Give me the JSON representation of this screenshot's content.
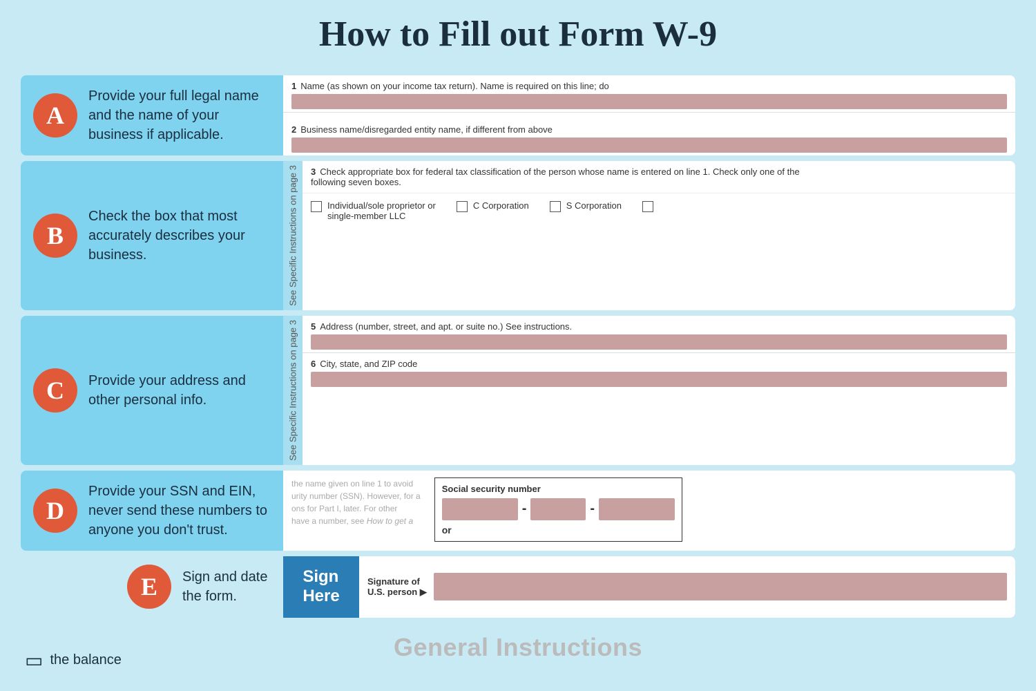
{
  "page": {
    "title": "How to Fill out Form W-9",
    "background_color": "#c8eaf5"
  },
  "sections": {
    "a": {
      "badge": "A",
      "description": "Provide your full legal name and the name of your business if applicable.",
      "field1_num": "1",
      "field1_label": "Name (as shown on your income tax return). Name is required on this line; do",
      "field2_num": "2",
      "field2_label": "Business name/disregarded entity name, if different from above"
    },
    "b": {
      "badge": "B",
      "description": "Check the box that most accurately describes your business.",
      "side_label": "See Specific Instructions on page 3",
      "field3_num": "3",
      "field3_label": "Check appropriate box for federal tax classification of the person whose name is entered on line 1. Check only one of the following seven boxes.",
      "checkboxes": [
        {
          "label": "Individual/sole proprietor or\nsingle-member LLC"
        },
        {
          "label": "C Corporation"
        },
        {
          "label": "S Corporation"
        },
        {
          "label": ""
        }
      ]
    },
    "c": {
      "badge": "C",
      "description": "Provide your address and other personal info.",
      "side_label": "See Specific Instructions on page 3",
      "field5_num": "5",
      "field5_label": "Address (number, street, and apt. or suite no.) See instructions.",
      "field6_num": "6",
      "field6_label": "City, state, and ZIP code"
    },
    "d": {
      "badge": "D",
      "description": "Provide your SSN and EIN, never send these numbers to anyone you don't trust.",
      "ssn_text": "the name given on line 1 to avoid\nurity number (SSN). However, for a\nons for Part I, later. For other\nhave a number, see How to get a",
      "ssn_title": "Social security number",
      "ssn_or": "or"
    },
    "e": {
      "badge": "E",
      "description": "Sign and date the form.",
      "sign_here": "Sign\nHere",
      "sig_label": "Signature of\nU.S. person ▶"
    }
  },
  "footer": {
    "general_instructions": "General Instructions",
    "logo_text": "the balance"
  }
}
